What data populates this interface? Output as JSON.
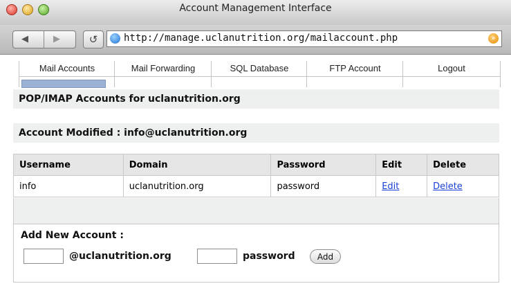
{
  "window": {
    "title": "Account Management Interface"
  },
  "browser": {
    "url": "http://manage.uclanutrition.org/mailaccount.php",
    "back_icon": "arrow-left",
    "forward_icon": "arrow-right",
    "reload_glyph": "↺",
    "rss_glyph": "»"
  },
  "tabs": [
    {
      "label": "Mail Accounts",
      "active": true
    },
    {
      "label": "Mail Forwarding",
      "active": false
    },
    {
      "label": "SQL Database",
      "active": false
    },
    {
      "label": "FTP Account",
      "active": false
    },
    {
      "label": "Logout",
      "active": false
    }
  ],
  "page": {
    "heading": "POP/IMAP Accounts for uclanutrition.org",
    "status": "Account Modified : info@uclanutrition.org"
  },
  "accounts_table": {
    "headers": [
      "Username",
      "Domain",
      "Password",
      "Edit",
      "Delete"
    ],
    "rows": [
      {
        "username": "info",
        "domain": "uclanutrition.org",
        "password": "password",
        "edit": "Edit",
        "delete": "Delete"
      }
    ]
  },
  "add_account": {
    "title": "Add New Account :",
    "domain_suffix": "@uclanutrition.org",
    "username_value": "",
    "password_label": "password",
    "password_value": "",
    "button_label": "Add"
  },
  "colors": {
    "link": "#1a3fd6",
    "active_tab_indicator": "#9bb2d6",
    "section_bg": "#eef0f0"
  }
}
